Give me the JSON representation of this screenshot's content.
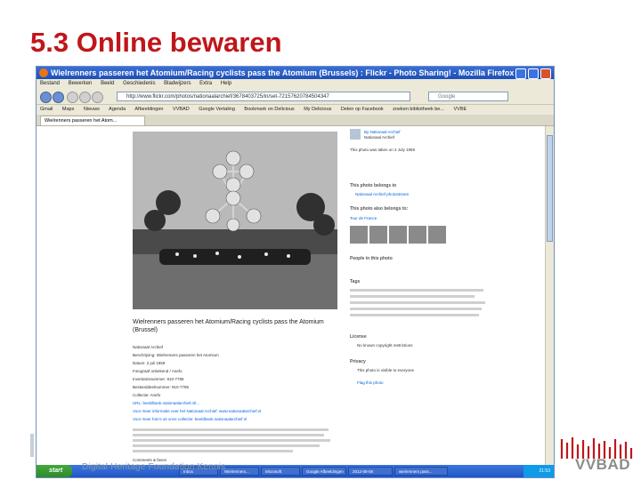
{
  "slide": {
    "title": "5.3 Online bewaren",
    "footer": "Digital Heritage Foundation Kennis"
  },
  "browser": {
    "window_title": "Wielrenners passeren het Atomium/Racing cyclists pass the Atomium (Brussels) : Flickr - Photo Sharing! - Mozilla Firefox",
    "menu": [
      "Bestand",
      "Bewerken",
      "Beeld",
      "Geschiedenis",
      "Bladwijzers",
      "Extra",
      "Help"
    ],
    "url": "http://www.flickr.com/photos/nationaalarchief/3678403725/in/set-72157620784504347",
    "search_placeholder": "Google",
    "bookmarks": [
      "Gmail",
      "Maps",
      "Nieuws",
      "Agenda",
      "Afbeeldingen",
      "VVBAD",
      "Google Vertaling",
      "Bookmark on Delicious",
      "My Delicious",
      "Delen op Facebook",
      "zoeken bibliotheek be...",
      "VVBE"
    ],
    "tab_label": "Wielrenners passeren het Atom..."
  },
  "flickr": {
    "photo_title": "Wielrenners passeren het Atomium/Racing cyclists pass the Atomium (Brussel)",
    "meta_lines": [
      "Nationaal Archief",
      "Beschrijving: Wielrenners passeren het Atomium",
      "Datum: 2 juli 1959",
      "Fotograaf onbekend / Anefo",
      "Inventarisnummer: 910-7786",
      "Bestanddeelnummer: 910-7786",
      "Collectie: Anefo"
    ],
    "meta_links": [
      "URL: beeldbank.nationaalarchief.nl/...",
      "Voor meer informatie over het Nationaal Archief: www.nationaalarchief.nl",
      "Voor meer foto's uit onze collectie: beeldbank.nationaalarchief.nl"
    ],
    "comments_label": "Comments & faves",
    "owner": "By Nationaal Archief",
    "owner_sub": "Nationaal Archief",
    "sidebar": [
      {
        "text": "This photo was taken on 2 July 1959",
        "style": "normal"
      },
      {
        "text": "This photo belongs to",
        "style": "head"
      },
      {
        "text": "Nationaal Archief photostream",
        "style": "blue"
      },
      {
        "text": "This photo also belongs to:",
        "style": "head"
      },
      {
        "text": "Tour de France",
        "style": "blue"
      },
      {
        "text": "People in this photo",
        "style": "head"
      },
      {
        "text": "Tags",
        "style": "head"
      },
      {
        "text": "License",
        "style": "head"
      },
      {
        "text": "No known copyright restrictions",
        "style": "normal"
      },
      {
        "text": "Privacy",
        "style": "head"
      },
      {
        "text": "This photo is visible to everyone",
        "style": "normal"
      },
      {
        "text": "Flag this photo",
        "style": "blue"
      }
    ]
  },
  "taskbar": {
    "start_label": "start",
    "items": [
      "Inbox",
      "Wielrenners...",
      "Microsoft",
      "Google Afbeeldingen",
      "2012-08-08",
      "wielrenners pass..."
    ],
    "clock": "21:53"
  },
  "logo": {
    "text": "VVBAD"
  },
  "colors": {
    "title_red": "#c0161b",
    "logo_red": "#c0161b",
    "logo_gray": "#8c8c8c"
  }
}
